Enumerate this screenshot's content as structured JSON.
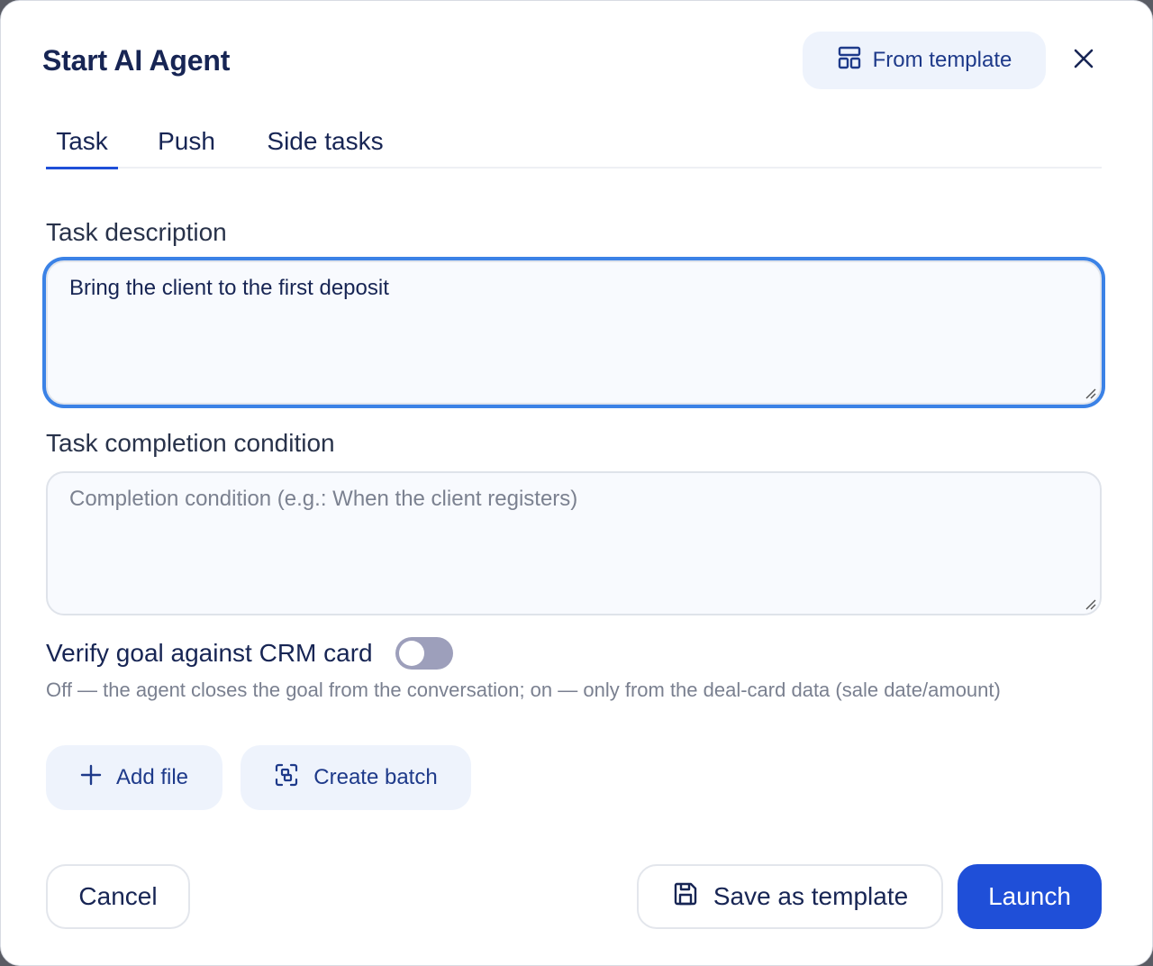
{
  "modal": {
    "title": "Start AI Agent",
    "from_template_label": "From template"
  },
  "tabs": [
    {
      "label": "Task",
      "active": true
    },
    {
      "label": "Push",
      "active": false
    },
    {
      "label": "Side tasks",
      "active": false
    }
  ],
  "task_description": {
    "label": "Task description",
    "value": "Bring the client to the first deposit"
  },
  "completion_condition": {
    "label": "Task completion condition",
    "value": "",
    "placeholder": "Completion condition (e.g.: When the client registers)"
  },
  "verify_goal": {
    "label": "Verify goal against CRM card",
    "enabled": false,
    "hint": "Off — the agent closes the goal from the conversation; on — only from the deal-card data (sale date/amount)"
  },
  "actions": {
    "add_file_label": "Add file",
    "create_batch_label": "Create batch"
  },
  "footer": {
    "cancel_label": "Cancel",
    "save_template_label": "Save as template",
    "launch_label": "Launch"
  },
  "colors": {
    "primary": "#1f4fd8",
    "focus_ring": "#3b82e6",
    "soft_button_bg": "#eef3fc",
    "toggle_off": "#9d9fbb",
    "text_dark": "#172554"
  },
  "icons": {
    "from_template": "layout-template-icon",
    "close": "close-icon",
    "add_file": "plus-icon",
    "create_batch": "scan-batch-icon",
    "save_template": "floppy-disk-icon"
  }
}
